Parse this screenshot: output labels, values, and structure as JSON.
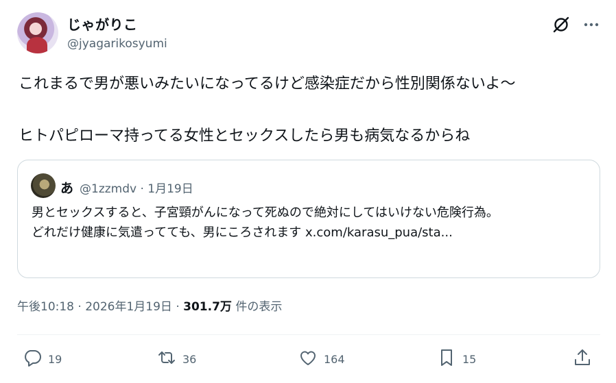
{
  "author": {
    "display_name": "じゃがりこ",
    "handle": "@jyagarikosyumi"
  },
  "tweet": {
    "text": "これまるで男が悪いみたいになってるけど感染症だから性別関係ないよ〜\n\nヒトパピローマ持ってる女性とセックスしたら男も病気なるからね"
  },
  "quote": {
    "display_name": "あ",
    "meta": "@1zzmdv · 1月19日",
    "text": "男とセックスすると、子宮頸がんになって死ぬので絶対にしてはいけない危険行為。\nどれだけ健康に気遣ってても、男にころされます x.com/karasu_pua/sta..."
  },
  "timestamp": {
    "time_date": "午後10:18 · 2026年1月19日 · ",
    "views": "301.7万",
    "views_suffix": " 件の表示"
  },
  "actions": {
    "reply_count": "19",
    "retweet_count": "36",
    "like_count": "164",
    "bookmark_count": "15"
  },
  "icons": [
    "grok-icon",
    "more-icon",
    "reply-icon",
    "retweet-icon",
    "like-icon",
    "bookmark-icon",
    "share-icon"
  ],
  "colors": {
    "text": "#0f1419",
    "secondary": "#536471",
    "border": "#cfd9de"
  }
}
